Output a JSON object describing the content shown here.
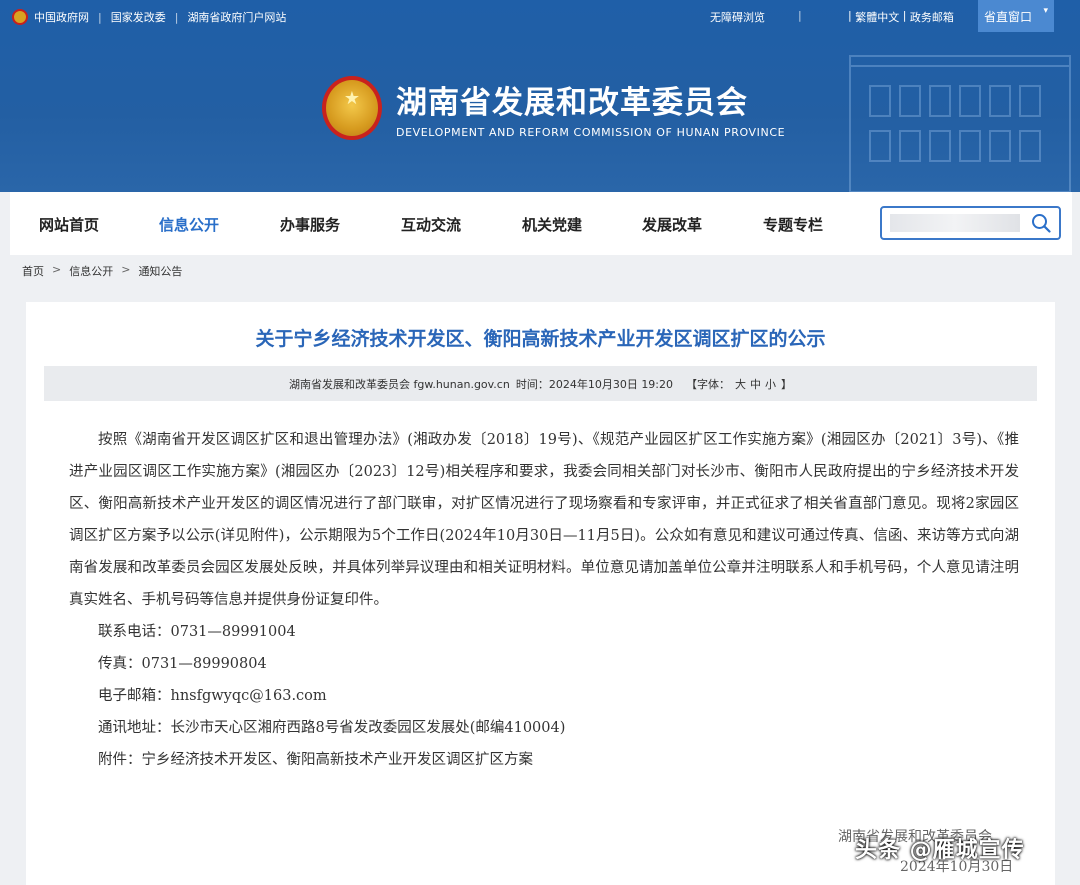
{
  "topbar": {
    "links": [
      "中国政府网",
      "国家发改委",
      "湖南省政府门户网站"
    ],
    "accessibility": "无障碍浏览",
    "lang": "繁體中文",
    "mail": "政务邮箱",
    "province_window": "省直窗口"
  },
  "brand": {
    "name_cn": "湖南省发展和改革委员会",
    "name_en": "DEVELOPMENT AND REFORM COMMISSION OF HUNAN PROVINCE"
  },
  "nav": {
    "items": [
      "网站首页",
      "信息公开",
      "办事服务",
      "互动交流",
      "机关党建",
      "发展改革",
      "专题专栏"
    ],
    "active_index": 1
  },
  "search": {
    "placeholder": ""
  },
  "breadcrumb": [
    "首页",
    "信息公开",
    "通知公告"
  ],
  "article": {
    "title": "关于宁乡经济技术开发区、衡阳高新技术产业开发区调区扩区的公示",
    "meta": {
      "source": "湖南省发展和改革委员会 fgw.hunan.gov.cn",
      "time": "时间：2024年10月30日 19:20",
      "font_label": "【字体：",
      "font_options": [
        "大",
        "中",
        "小"
      ],
      "font_end": "】"
    },
    "body": "按照《湖南省开发区调区扩区和退出管理办法》(湘政办发〔2018〕19号)、《规范产业园区扩区工作实施方案》(湘园区办〔2021〕3号)、《推进产业园区调区工作实施方案》(湘园区办〔2023〕12号)相关程序和要求，我委会同相关部门对长沙市、衡阳市人民政府提出的宁乡经济技术开发区、衡阳高新技术产业开发区的调区情况进行了部门联审，对扩区情况进行了现场察看和专家评审，并正式征求了相关省直部门意见。现将2家园区调区扩区方案予以公示(详见附件)，公示期限为5个工作日(2024年10月30日—11月5日)。公众如有意见和建议可通过传真、信函、来访等方式向湖南省发展和改革委员会园区发展处反映，并具体列举异议理由和相关证明材料。单位意见请加盖单位公章并注明联系人和手机号码，个人意见请注明真实姓名、手机号码等信息并提供身份证复印件。",
    "phone": "联系电话：0731—89991004",
    "fax": "传真：0731—89990804",
    "email": "电子邮箱：hnsfgwyqc@163.com",
    "address": "通讯地址：长沙市天心区湘府西路8号省发改委园区发展处(邮编410004)",
    "attachment": "附件：宁乡经济技术开发区、衡阳高新技术产业开发区调区扩区方案",
    "signature": "湖南省发展和改革委员会",
    "sign_date": "2024年10月30日"
  },
  "watermark": "头条 @雁城宣传",
  "colors": {
    "header_blue": "#235fa3",
    "accent_blue": "#2a6fc9",
    "title_blue": "#2a66b8"
  }
}
